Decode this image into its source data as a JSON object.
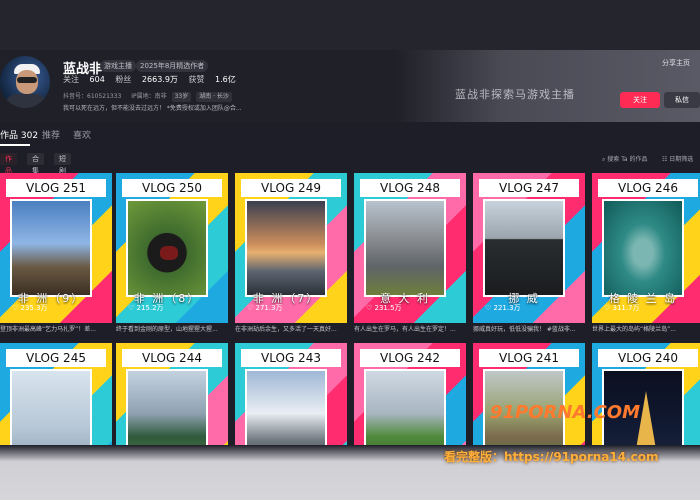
{
  "profile": {
    "name": "蓝战非",
    "badges": [
      "游戏主播",
      "2025年8月精选作者"
    ],
    "stats": [
      {
        "label": "关注",
        "value": "604"
      },
      {
        "label": "粉丝",
        "value": "2663.9万"
      },
      {
        "label": "获赞",
        "value": "1.6亿"
      }
    ],
    "id_label": "抖音号：610521333",
    "ip_label": "IP属地：南非",
    "chips": [
      "33岁",
      "湖南 · 长沙"
    ],
    "bio": "我可以死在远方，但不能没去过远方！  *免费授权或加入团队@合...",
    "banner_text": "蓝战非探索马游戏主播",
    "share": "分享主页",
    "follow": "关注",
    "message": "私信"
  },
  "tabs": [
    {
      "label": "作品 302",
      "active": true
    },
    {
      "label": "推荐",
      "active": false
    },
    {
      "label": "喜欢",
      "active": false
    }
  ],
  "filters": [
    {
      "label": "作品",
      "active": true
    },
    {
      "label": "合集",
      "active": false
    },
    {
      "label": "短剧",
      "active": false
    }
  ],
  "search_works": "搜索 Ta 的作品",
  "sort": "日期筛选",
  "videos": [
    {
      "title": "VLOG 251",
      "place": "非 洲（9）",
      "views": "235.3万",
      "caption": "登顶非洲最高峰“乞力马扎罗”！差...",
      "scene": "mountain_flag"
    },
    {
      "title": "VLOG 250",
      "place": "非 洲（8）",
      "views": "215.2万",
      "caption": "终于看到金刚的原型，山地猩猩大猩...",
      "scene": "gorilla"
    },
    {
      "title": "VLOG 249",
      "place": "非 洲（7）",
      "views": "271.3万",
      "caption": "在非洲劫后余生，又多活了一天真好...",
      "scene": "sunset"
    },
    {
      "title": "VLOG 248",
      "place": "意 大 利",
      "views": "231.5万",
      "caption": "有人出生在罗马，有人出生在罗定！...",
      "scene": "dolomites"
    },
    {
      "title": "VLOG 247",
      "place": "挪 威",
      "views": "221.3万",
      "caption": "挪威真好玩，低低没骗我！ #蓝战非...",
      "scene": "kjerag"
    },
    {
      "title": "VLOG 246",
      "place": "格 陵 兰 岛",
      "views": "311.7万",
      "caption": "世界上最大的岛屿“格陵兰岛”...",
      "scene": "whale"
    },
    {
      "title": "VLOG 245",
      "place": "",
      "views": "",
      "caption": "",
      "scene": "cliff_sea"
    },
    {
      "title": "VLOG 244",
      "place": "",
      "views": "",
      "caption": "",
      "scene": "forest_valley"
    },
    {
      "title": "VLOG 243",
      "place": "",
      "views": "",
      "caption": "",
      "scene": "snow_peak"
    },
    {
      "title": "VLOG 242",
      "place": "",
      "views": "",
      "caption": "",
      "scene": "green_cliff"
    },
    {
      "title": "VLOG 241",
      "place": "",
      "views": "",
      "caption": "",
      "scene": "canyon"
    },
    {
      "title": "VLOG 240",
      "place": "",
      "views": "",
      "caption": "",
      "scene": "eiffel"
    }
  ],
  "watermark": {
    "brand": "91PORNA.COM",
    "line": "看完整版：https://91porna14.com"
  },
  "colors": {
    "accent": "#fe2c55",
    "card_colors": [
      "#ff2d6f",
      "#1ea9e1",
      "#ffd31a",
      "#2ccbd6",
      "#ff6aa8"
    ]
  }
}
